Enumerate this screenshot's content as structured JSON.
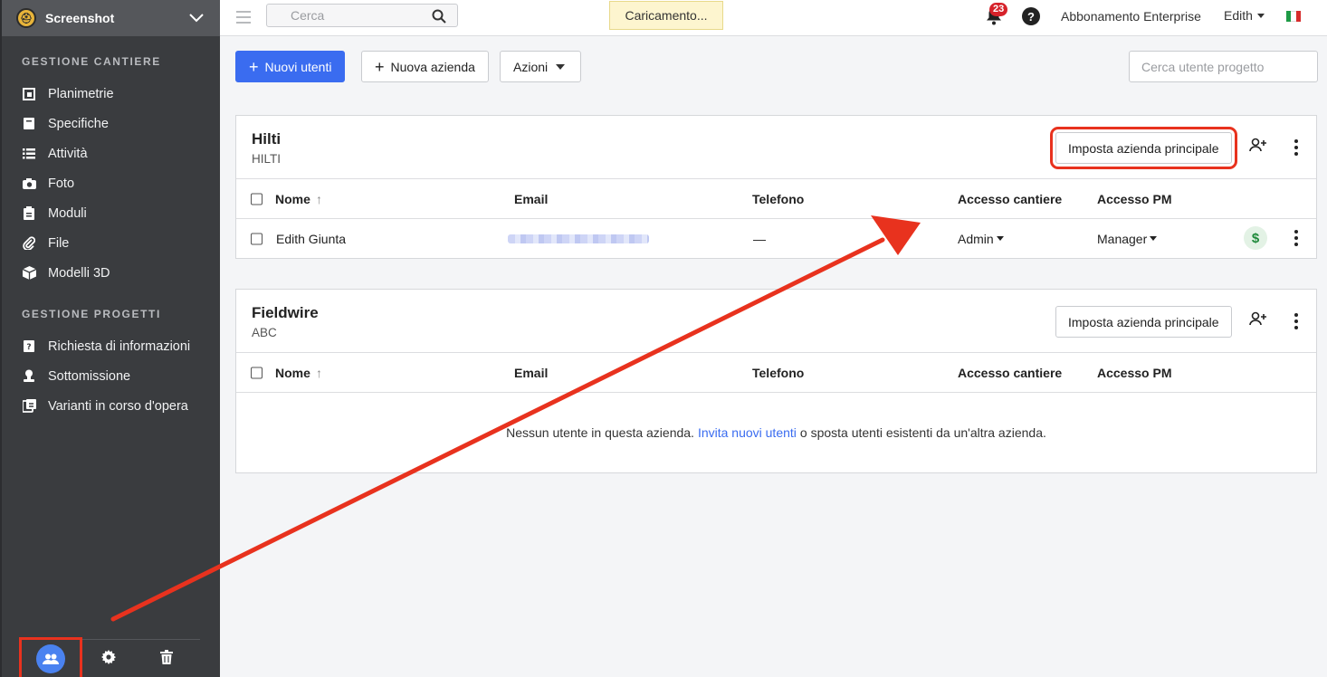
{
  "sidebar": {
    "project_name": "Screenshot",
    "section_site": "GESTIONE CANTIERE",
    "site_items": [
      {
        "label": "Planimetrie",
        "icon": "floorplan-icon"
      },
      {
        "label": "Specifiche",
        "icon": "book-icon"
      },
      {
        "label": "Attività",
        "icon": "list-icon"
      },
      {
        "label": "Foto",
        "icon": "camera-icon"
      },
      {
        "label": "Moduli",
        "icon": "clipboard-icon"
      },
      {
        "label": "File",
        "icon": "paperclip-icon"
      },
      {
        "label": "Modelli 3D",
        "icon": "cube-icon"
      }
    ],
    "section_project": "GESTIONE PROGETTI",
    "project_items": [
      {
        "label": "Richiesta di informazioni",
        "icon": "book-question-icon"
      },
      {
        "label": "Sottomissione",
        "icon": "person-stamp-icon"
      },
      {
        "label": "Varianti in corso d'opera",
        "icon": "change-order-icon"
      }
    ]
  },
  "topbar": {
    "search_placeholder": "Cerca",
    "loading": "Caricamento...",
    "notifications": "23",
    "help": "?",
    "plan": "Abbonamento Enterprise",
    "user": "Edith"
  },
  "toolbar": {
    "new_users": "Nuovi utenti",
    "new_company": "Nuova azienda",
    "actions": "Azioni",
    "user_search_placeholder": "Cerca utente progetto"
  },
  "table_headers": {
    "name": "Nome",
    "sort": "↑",
    "email": "Email",
    "phone": "Telefono",
    "site_access": "Accesso cantiere",
    "pm_access": "Accesso PM"
  },
  "set_main_label": "Imposta azienda principale",
  "companies": [
    {
      "name": "Hilti",
      "code": "HILTI",
      "users": [
        {
          "name": "Edith Giunta",
          "phone": "—",
          "site_access": "Admin",
          "pm_access": "Manager",
          "billing": "$"
        }
      ]
    },
    {
      "name": "Fieldwire",
      "code": "ABC",
      "empty": {
        "before": "Nessun utente in questa azienda.",
        "link": "Invita nuovi utenti",
        "after": "o sposta utenti esistenti da un'altra azienda."
      }
    }
  ],
  "colors": {
    "primary": "#3a6cf0",
    "sidebar": "#3a3c3f",
    "highlight": "#e8321e",
    "badge": "#d6222a"
  }
}
